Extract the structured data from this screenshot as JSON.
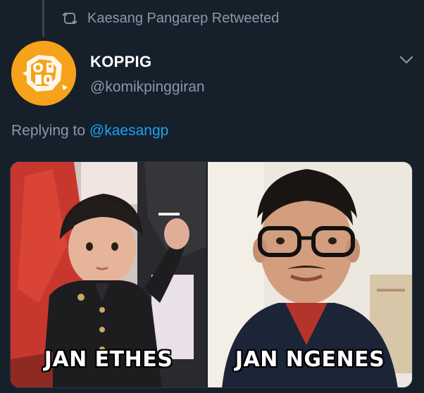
{
  "retweet": {
    "icon": "retweet-icon",
    "label": "Kaesang Pangarep Retweeted"
  },
  "tweet": {
    "avatar_icon": "koppig-logo-avatar",
    "avatar_color": "#f7a21b",
    "display_name": "KOPPIG",
    "handle": "@komikpinggiran",
    "menu_icon": "chevron-down-icon",
    "replying_to_prefix": "Replying to ",
    "replying_to_handle": "@kaesangp",
    "media": {
      "left_caption": "JAN ETHES",
      "right_caption": "JAN NGENES"
    }
  },
  "colors": {
    "background": "#15202b",
    "secondary_text": "#8899a6",
    "link": "#1da1f2"
  }
}
